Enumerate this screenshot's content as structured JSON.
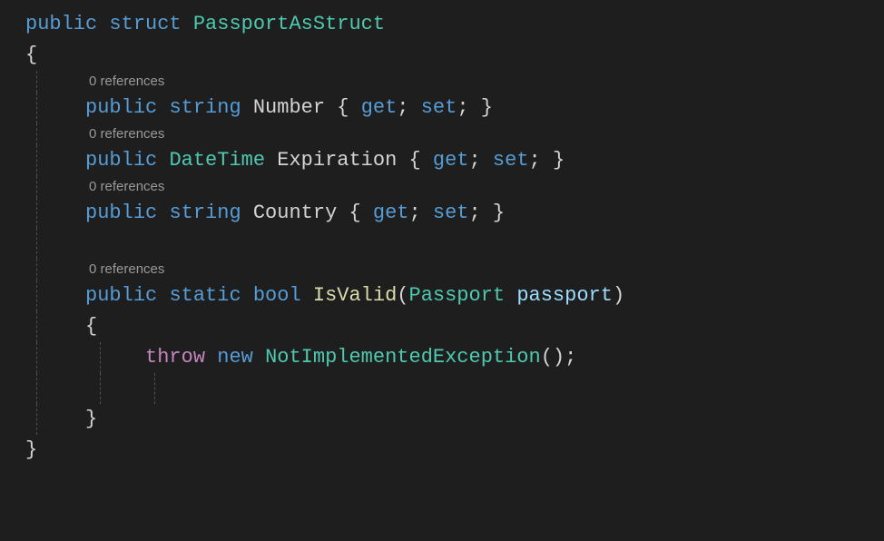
{
  "code": {
    "kw_public": "public",
    "kw_struct": "struct",
    "kw_static": "static",
    "kw_string": "string",
    "kw_bool": "bool",
    "kw_get": "get",
    "kw_set": "set",
    "kw_throw": "throw",
    "kw_new": "new",
    "type_struct": "PassportAsStruct",
    "type_datetime": "DateTime",
    "type_passport": "Passport",
    "type_exception": "NotImplementedException",
    "prop_number": "Number",
    "prop_expiration": "Expiration",
    "prop_country": "Country",
    "method_isvalid": "IsValid",
    "param_passport": "passport",
    "open_brace": "{",
    "close_brace": "}",
    "open_paren": "(",
    "close_paren": ")",
    "semicolon": ";",
    "parens_empty": "()",
    "space": " "
  },
  "codelens": {
    "refs": "0 references"
  }
}
